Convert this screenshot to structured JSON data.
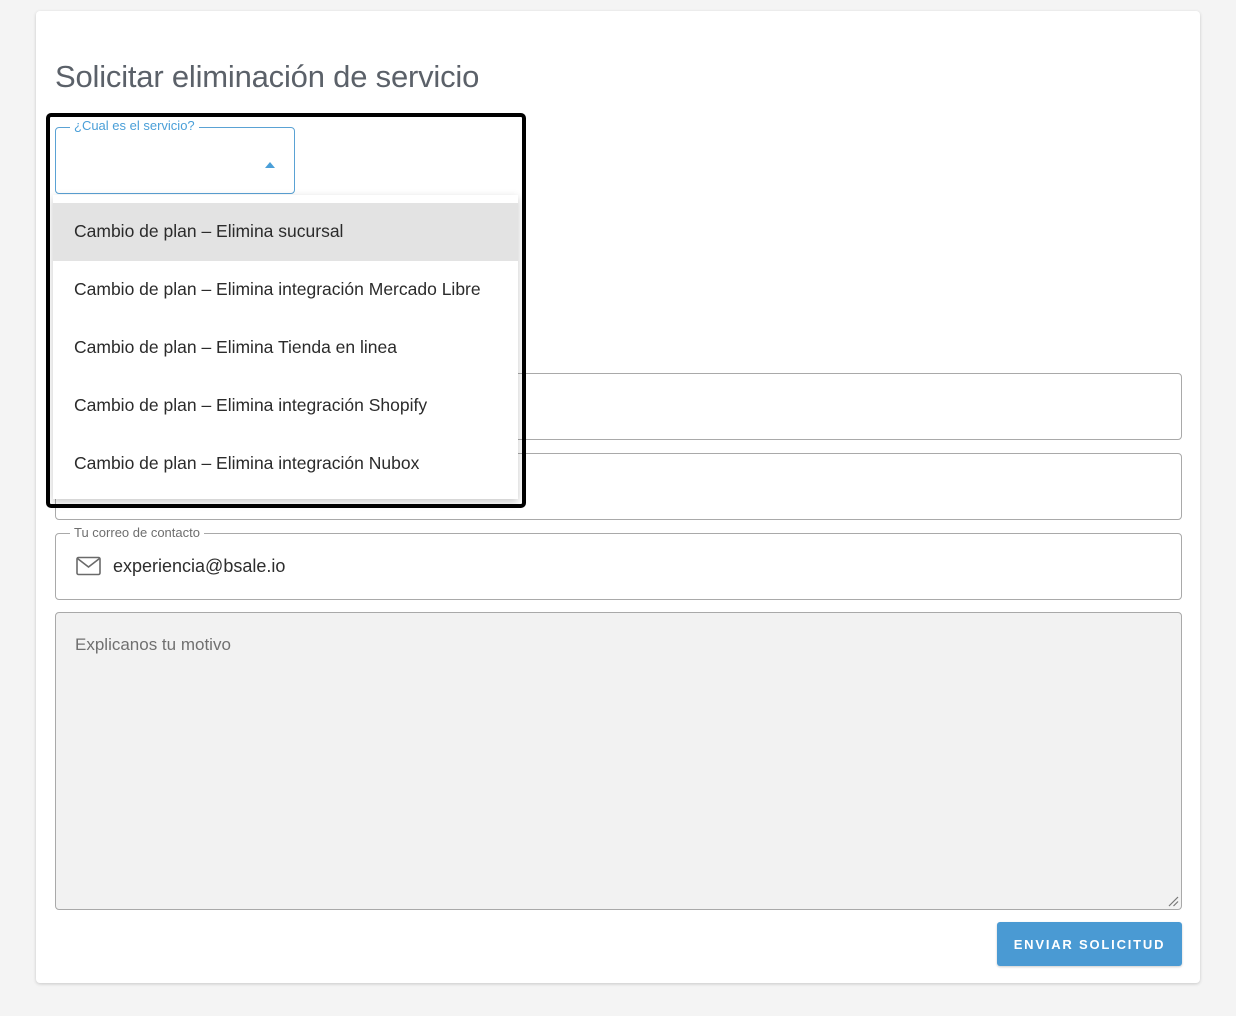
{
  "form": {
    "title": "Solicitar eliminación de servicio",
    "service_select": {
      "label": "¿Cual es el servicio?",
      "value": "",
      "options": [
        "Cambio de plan – Elimina sucursal",
        "Cambio de plan – Elimina integración Mercado Libre",
        "Cambio de plan – Elimina Tienda en linea",
        "Cambio de plan – Elimina integración Shopify",
        "Cambio de plan – Elimina integración Nubox"
      ],
      "highlighted_option": "Cambio de plan – Elimina sucursal"
    },
    "contact_email": {
      "label": "Tu correo de contacto",
      "value": "experiencia@bsale.io",
      "icon": "mail-icon"
    },
    "reason": {
      "placeholder": "Explicanos tu motivo",
      "value": ""
    },
    "submit_label": "ENVIAR SOLICITUD"
  },
  "colors": {
    "accent": "#4a9ad3",
    "highlight_frame": "#000000",
    "selected_option_bg": "#e3e3e3"
  }
}
